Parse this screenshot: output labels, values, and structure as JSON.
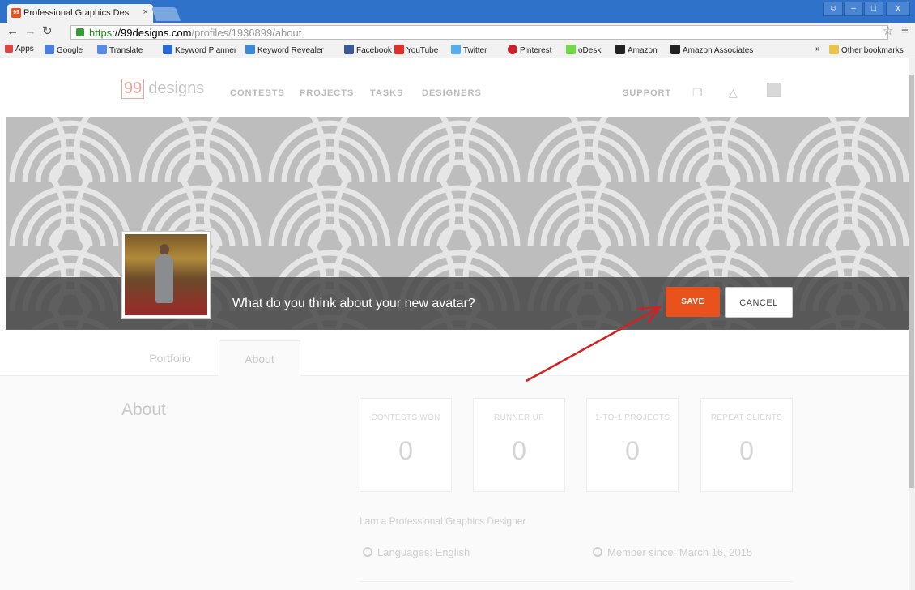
{
  "browser": {
    "tab_title": "Professional Graphics Des",
    "tab_close": "×",
    "favicon_text": "99",
    "url_secure": "https",
    "url_host": "://99designs.com",
    "url_path": "/profiles/1936899/about",
    "bookmarks": [
      "Apps",
      "Google",
      "Translate",
      "Keyword Planner",
      "Keyword Revealer",
      "Facebook",
      "YouTube",
      "Twitter",
      "Pinterest",
      "oDesk",
      "Amazon",
      "Amazon Associates"
    ],
    "more": "»",
    "other_bookmarks": "Other bookmarks"
  },
  "header": {
    "logo_box": "99",
    "logo_text": "designs",
    "nav": [
      "CONTESTS",
      "PROJECTS",
      "TASKS",
      "DESIGNERS"
    ],
    "support": "SUPPORT"
  },
  "avatar_prompt": {
    "question": "What do you think about your new avatar?",
    "save": "SAVE",
    "cancel": "CANCEL"
  },
  "profile_tabs": [
    "Portfolio",
    "About"
  ],
  "about": {
    "heading": "About",
    "stats": [
      {
        "label": "CONTESTS WON",
        "value": "0"
      },
      {
        "label": "RUNNER UP",
        "value": "0"
      },
      {
        "label": "1-TO-1 PROJECTS",
        "value": "0"
      },
      {
        "label": "REPEAT CLIENTS",
        "value": "0"
      }
    ],
    "bio": "I am a Professional Graphics Designer",
    "languages": "Languages: English",
    "member_since": "Member since: March 16, 2015"
  },
  "colors": {
    "accent": "#e9521c",
    "chrome": "#2f72c9",
    "arrow": "#d42020"
  }
}
